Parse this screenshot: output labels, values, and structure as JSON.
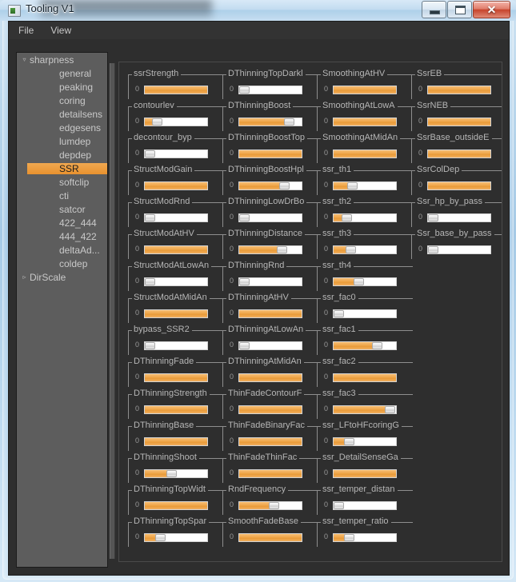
{
  "window": {
    "title": "Tooling V1",
    "icon": "app-icon",
    "buttons": {
      "minimize": "minimize",
      "maximize": "maximize",
      "close": "✕"
    }
  },
  "menubar": {
    "items": [
      {
        "label": "File"
      },
      {
        "label": "View"
      }
    ]
  },
  "tree": {
    "items": [
      {
        "label": "sharpness",
        "level": 0,
        "twisty": "▿",
        "selected": false
      },
      {
        "label": "general",
        "level": 1,
        "twisty": "",
        "selected": false
      },
      {
        "label": "peaking",
        "level": 1,
        "twisty": "",
        "selected": false
      },
      {
        "label": "coring",
        "level": 1,
        "twisty": "",
        "selected": false
      },
      {
        "label": "detailsens",
        "level": 1,
        "twisty": "",
        "selected": false
      },
      {
        "label": "edgesens",
        "level": 1,
        "twisty": "",
        "selected": false
      },
      {
        "label": "lumdep",
        "level": 1,
        "twisty": "",
        "selected": false
      },
      {
        "label": "depdep",
        "level": 1,
        "twisty": "",
        "selected": false
      },
      {
        "label": "SSR",
        "level": 1,
        "twisty": "",
        "selected": true
      },
      {
        "label": "softclip",
        "level": 1,
        "twisty": "",
        "selected": false
      },
      {
        "label": "cti",
        "level": 1,
        "twisty": "",
        "selected": false
      },
      {
        "label": "satcor",
        "level": 1,
        "twisty": "",
        "selected": false
      },
      {
        "label": "422_444",
        "level": 1,
        "twisty": "",
        "selected": false
      },
      {
        "label": "444_422",
        "level": 1,
        "twisty": "",
        "selected": false
      },
      {
        "label": "deltaAd...",
        "level": 1,
        "twisty": "",
        "selected": false
      },
      {
        "label": "coldep",
        "level": 1,
        "twisty": "",
        "selected": false
      },
      {
        "label": "DirScale",
        "level": 0,
        "twisty": "▹",
        "selected": false
      }
    ]
  },
  "accent_color": "#ec9b35",
  "parameters": {
    "min_label": "0",
    "columns": [
      {
        "items": [
          {
            "label": "ssrStrength",
            "fill": 100,
            "knob": null
          },
          {
            "label": "contourlev",
            "fill": 14,
            "knob": 14
          },
          {
            "label": "decontour_byp",
            "fill": 0,
            "knob": 0
          },
          {
            "label": "StructModGain",
            "fill": 100,
            "knob": null
          },
          {
            "label": "StructModRnd",
            "fill": 0,
            "knob": 0
          },
          {
            "label": "StructModAtHV",
            "fill": 100,
            "knob": null
          },
          {
            "label": "StructModAtLowAn",
            "fill": 0,
            "knob": 0
          },
          {
            "label": "StructModAtMidAn",
            "fill": 100,
            "knob": null
          },
          {
            "label": "bypass_SSR2",
            "fill": 0,
            "knob": 0
          },
          {
            "label": "DThinningFade",
            "fill": 100,
            "knob": null
          },
          {
            "label": "DThinningStrength",
            "fill": 100,
            "knob": null
          },
          {
            "label": "DThinningBase",
            "fill": 100,
            "knob": null
          },
          {
            "label": "DThinningShoot",
            "fill": 40,
            "knob": 40
          },
          {
            "label": "DThinningTopWidt",
            "fill": 100,
            "knob": null
          },
          {
            "label": "DThinningTopSpar",
            "fill": 20,
            "knob": 20
          }
        ]
      },
      {
        "items": [
          {
            "label": "DThinningTopDarkl",
            "fill": 0,
            "knob": 0
          },
          {
            "label": "DThinningBoost",
            "fill": 83,
            "knob": 83
          },
          {
            "label": "DThinningBoostTop",
            "fill": 100,
            "knob": null
          },
          {
            "label": "DThinningBoostHpl",
            "fill": 75,
            "knob": 75
          },
          {
            "label": "DThinningLowDrBo",
            "fill": 0,
            "knob": 0
          },
          {
            "label": "DThinningDistance",
            "fill": 70,
            "knob": 70
          },
          {
            "label": "DThinningRnd",
            "fill": 0,
            "knob": 0
          },
          {
            "label": "DThinningAtHV",
            "fill": 100,
            "knob": null
          },
          {
            "label": "DThinningAtLowAn",
            "fill": 0,
            "knob": 0
          },
          {
            "label": "DThinningAtMidAn",
            "fill": 100,
            "knob": null
          },
          {
            "label": "ThinFadeContourF",
            "fill": 100,
            "knob": null
          },
          {
            "label": "ThinFadeBinaryFac",
            "fill": 100,
            "knob": null
          },
          {
            "label": "ThinFadeThinFac",
            "fill": 100,
            "knob": null
          },
          {
            "label": "RndFrequency",
            "fill": 55,
            "knob": 55
          },
          {
            "label": "SmoothFadeBase",
            "fill": 100,
            "knob": null
          }
        ]
      },
      {
        "items": [
          {
            "label": "SmoothingAtHV",
            "fill": 100,
            "knob": null
          },
          {
            "label": "SmoothingAtLowA",
            "fill": 100,
            "knob": null
          },
          {
            "label": "SmoothingAtMidAn",
            "fill": 100,
            "knob": null
          },
          {
            "label": "ssr_th1",
            "fill": 25,
            "knob": 25
          },
          {
            "label": "ssr_th2",
            "fill": 15,
            "knob": 15
          },
          {
            "label": "ssr_th3",
            "fill": 22,
            "knob": 22
          },
          {
            "label": "ssr_th4",
            "fill": 38,
            "knob": 38
          },
          {
            "label": "ssr_fac0",
            "fill": 0,
            "knob": 0
          },
          {
            "label": "ssr_fac1",
            "fill": 72,
            "knob": 72
          },
          {
            "label": "ssr_fac2",
            "fill": 100,
            "knob": null
          },
          {
            "label": "ssr_fac3",
            "fill": 96,
            "knob": 96
          },
          {
            "label": "ssr_LFtoHFcoringG",
            "fill": 20,
            "knob": 20
          },
          {
            "label": "ssr_DetailSenseGa",
            "fill": 100,
            "knob": null
          },
          {
            "label": "ssr_temper_distan",
            "fill": 0,
            "knob": 0
          },
          {
            "label": "ssr_temper_ratio",
            "fill": 20,
            "knob": 20
          }
        ]
      },
      {
        "items": [
          {
            "label": "SsrEB",
            "fill": 100,
            "knob": null
          },
          {
            "label": "SsrNEB",
            "fill": 100,
            "knob": null
          },
          {
            "label": "SsrBase_outsideE",
            "fill": 100,
            "knob": null
          },
          {
            "label": "SsrColDep",
            "fill": 100,
            "knob": null
          },
          {
            "label": "Ssr_hp_by_pass",
            "fill": 0,
            "knob": 0
          },
          {
            "label": "Ssr_base_by_pass",
            "fill": 0,
            "knob": 0
          }
        ]
      }
    ]
  }
}
